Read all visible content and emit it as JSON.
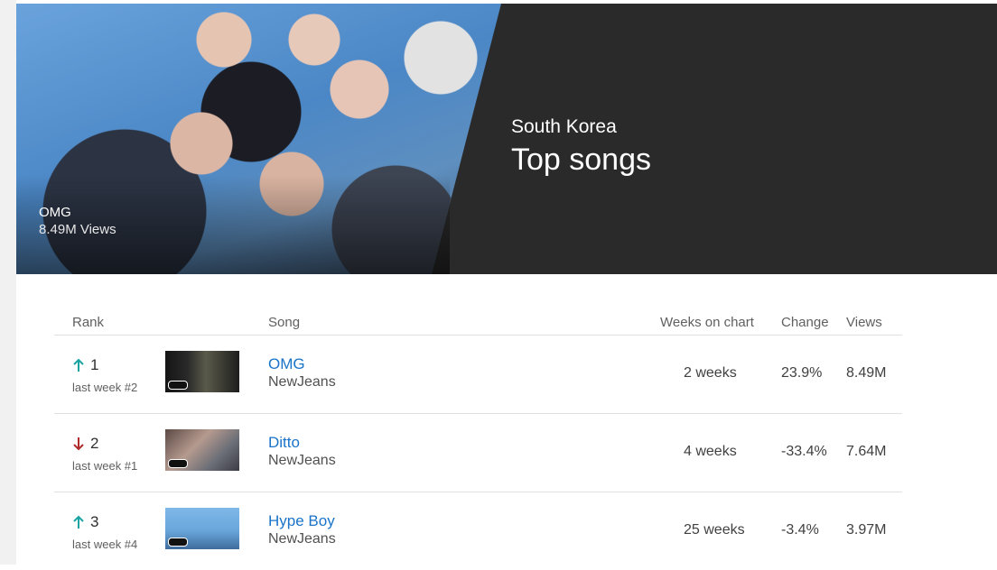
{
  "hero": {
    "featured_title": "OMG",
    "featured_views": "8.49M Views",
    "country": "South Korea",
    "heading": "Top songs"
  },
  "table": {
    "headers": {
      "rank": "Rank",
      "song": "Song",
      "weeks": "Weeks on chart",
      "change": "Change",
      "views": "Views"
    },
    "rows": [
      {
        "rank": "1",
        "trend": "up",
        "last_week": "last week #2",
        "title": "OMG",
        "artist": "NewJeans",
        "weeks": "2 weeks",
        "change": "23.9%",
        "views": "8.49M"
      },
      {
        "rank": "2",
        "trend": "down",
        "last_week": "last week #1",
        "title": "Ditto",
        "artist": "NewJeans",
        "weeks": "4 weeks",
        "change": "-33.4%",
        "views": "7.64M"
      },
      {
        "rank": "3",
        "trend": "up",
        "last_week": "last week #4",
        "title": "Hype Boy",
        "artist": "NewJeans",
        "weeks": "25 weeks",
        "change": "-3.4%",
        "views": "3.97M"
      }
    ]
  },
  "colors": {
    "up": "#1aa3a3",
    "down": "#b02a2a",
    "link": "#1a73c8",
    "hero_bg": "#2a2a2a"
  }
}
